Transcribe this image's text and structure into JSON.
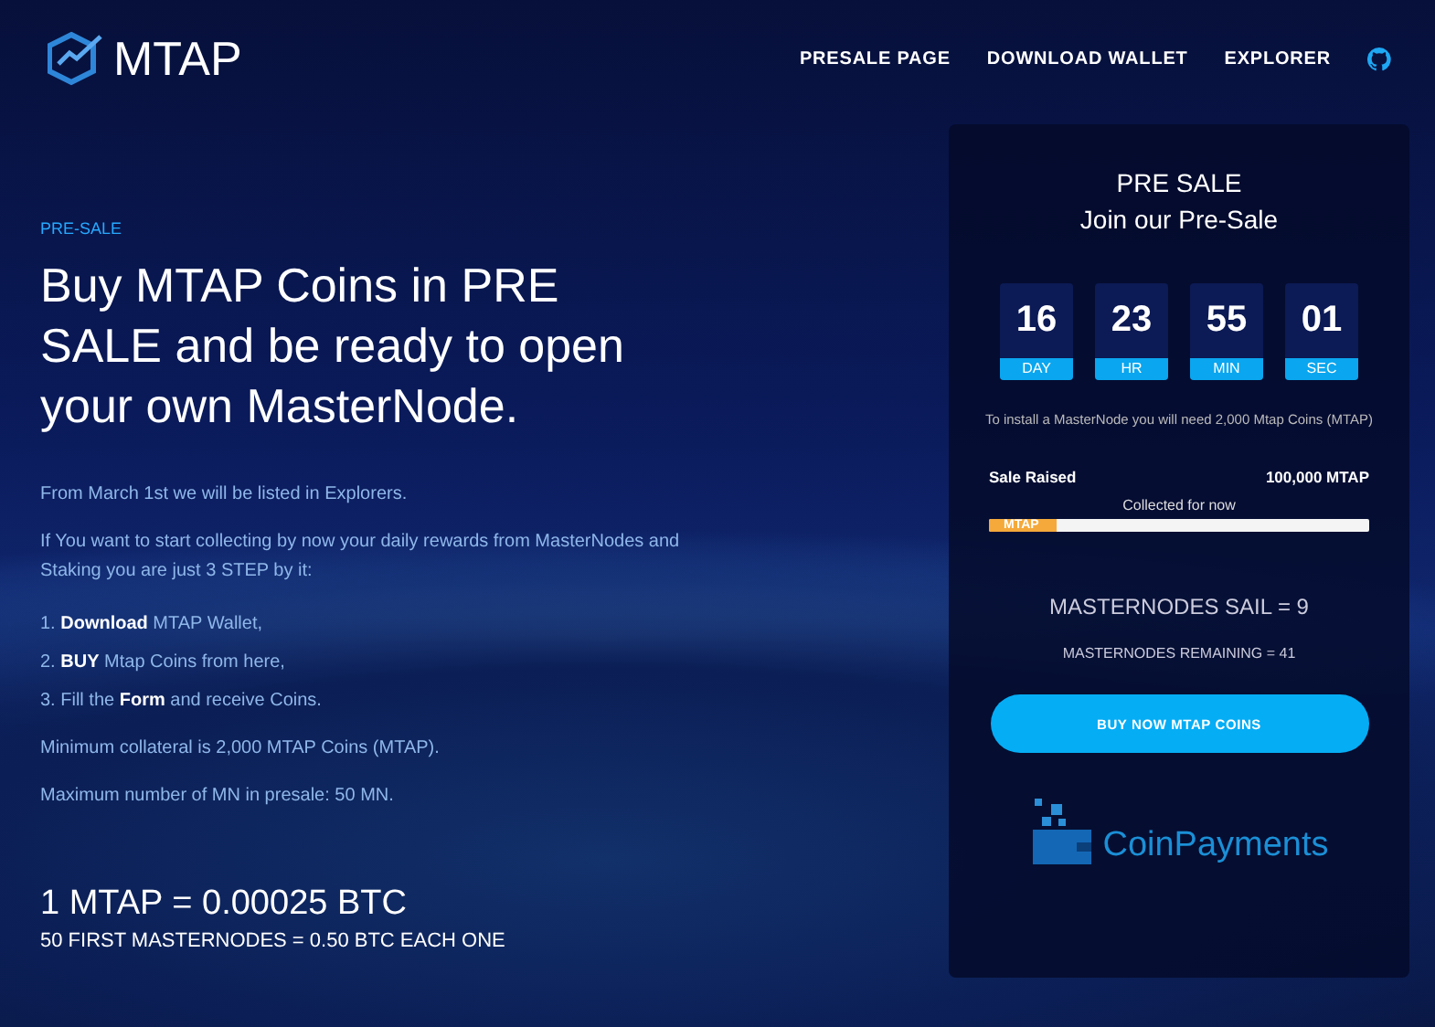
{
  "header": {
    "logo": "MTAP",
    "nav": [
      {
        "label": "PRESALE PAGE"
      },
      {
        "label": "DOWNLOAD WALLET"
      },
      {
        "label": "EXPLORER"
      }
    ]
  },
  "hero": {
    "eyebrow": "PRE-SALE",
    "title": "Buy MTAP Coins in PRE SALE and be ready to open your own MasterNode.",
    "paragraphs": [
      "From March 1st we will be listed in Explorers.",
      "If  You want to start collecting by now your daily rewards from MasterNodes and Staking you are just 3 STEP by it:"
    ],
    "steps": [
      "1. **Download** MTAP Wallet,",
      "2. **BUY** Mtap Coins from here,",
      "3. Fill the **Form** and receive Coins."
    ],
    "notes": [
      "Minimum collateral is 2,000 MTAP Coins (MTAP).",
      "Maximum number of MN in presale: 50 MN."
    ],
    "price": "1 MTAP = 0.00025 BTC",
    "offer": "50 FIRST MASTERNODES = 0.50 BTC EACH ONE"
  },
  "card": {
    "title": "PRE SALE",
    "subtitle": "Join our Pre-Sale",
    "countdown": [
      {
        "value": "16",
        "unit": "DAY"
      },
      {
        "value": "23",
        "unit": "HR"
      },
      {
        "value": "55",
        "unit": "MIN"
      },
      {
        "value": "01",
        "unit": "SEC"
      }
    ],
    "install_note": "To install a MasterNode you will need 2,000 Mtap Coins (MTAP)",
    "raised_label": "Sale Raised",
    "raised_value": "100,000 MTAP",
    "progress_caption": "Collected for now",
    "progress": {
      "label": "MTAP",
      "level": 0.18
    },
    "sold": "MASTERNODES SAIL = 9",
    "remaining": "MASTERNODES REMAINING = 41",
    "button": "BUY NOW MTAP COINS",
    "payments_logo": "CoinPayments"
  }
}
